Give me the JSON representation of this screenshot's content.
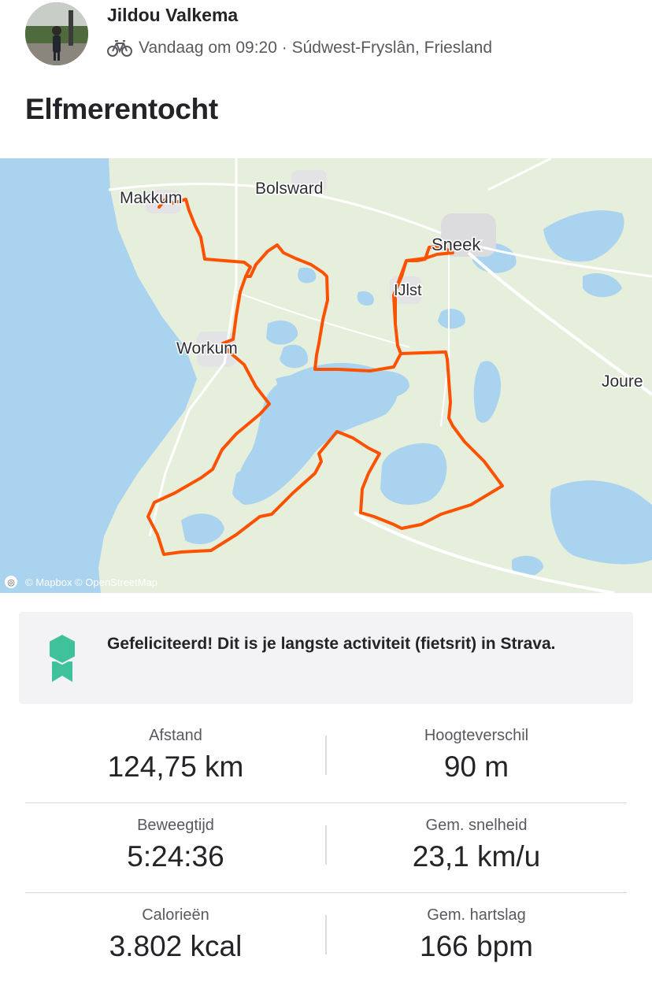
{
  "athlete": {
    "name": "Jildou Valkema"
  },
  "activity": {
    "type_icon": "bike-icon",
    "meta": "Vandaag om 09:20 · Súdwest-Fryslân, Friesland",
    "title": "Elfmerentocht"
  },
  "map": {
    "labels": {
      "makkum": "Makkum",
      "bolsward": "Bolsward",
      "sneek": "Sneek",
      "ijlst": "IJlst",
      "workum": "Workum",
      "joure": "Joure"
    },
    "attribution": "© Mapbox © OpenStreetMap",
    "colors": {
      "land": "#e6efdc",
      "water": "#a9d3ee",
      "route": "#fc5200",
      "road": "#ffffff"
    }
  },
  "achievement": {
    "icon": "medal-icon",
    "text": "Gefeliciteerd! Dit is je langste activiteit (fietsrit) in Strava.",
    "color": "#3fc29a"
  },
  "stats": [
    {
      "label": "Afstand",
      "value": "124,75 km"
    },
    {
      "label": "Hoogteverschil",
      "value": "90 m"
    },
    {
      "label": "Beweegtijd",
      "value": "5:24:36"
    },
    {
      "label": "Gem. snelheid",
      "value": "23,1 km/u"
    },
    {
      "label": "Calorieën",
      "value": "3.802 kcal"
    },
    {
      "label": "Gem. hartslag",
      "value": "166 bpm"
    }
  ]
}
